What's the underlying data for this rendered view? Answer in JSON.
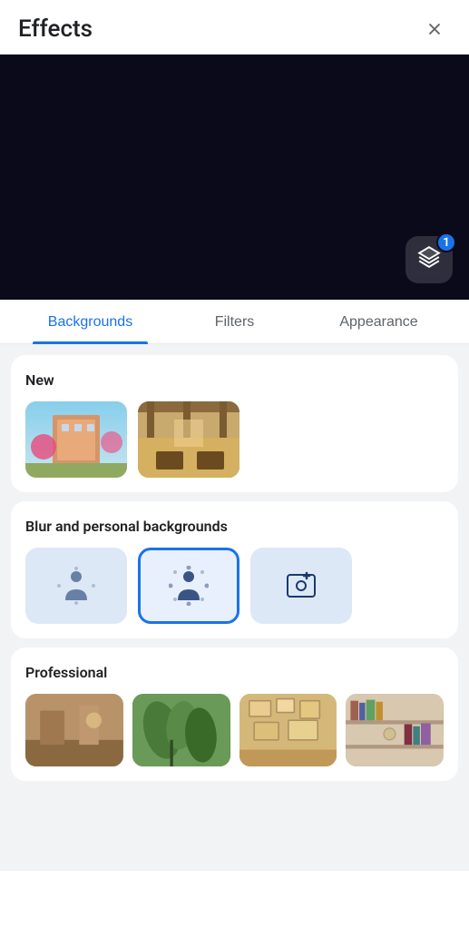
{
  "header": {
    "title": "Effects",
    "close_label": "Close"
  },
  "tabs": [
    {
      "id": "backgrounds",
      "label": "Backgrounds",
      "active": true
    },
    {
      "id": "filters",
      "label": "Filters",
      "active": false
    },
    {
      "id": "appearance",
      "label": "Appearance",
      "active": false
    }
  ],
  "sections": {
    "new": {
      "title": "New",
      "items": [
        {
          "id": "thumb1",
          "alt": "Background 1 - outdoor scene"
        },
        {
          "id": "thumb2",
          "alt": "Background 2 - indoor scene"
        }
      ]
    },
    "blur": {
      "title": "Blur and personal backgrounds",
      "items": [
        {
          "id": "blur-light",
          "type": "blur-light",
          "selected": false,
          "label": "Slight blur"
        },
        {
          "id": "blur-strong",
          "type": "blur-strong",
          "selected": true,
          "label": "Strong blur"
        },
        {
          "id": "add-photo",
          "type": "add",
          "label": "Add photo"
        }
      ]
    },
    "professional": {
      "title": "Professional",
      "items": [
        {
          "id": "pro1",
          "alt": "Professional background 1"
        },
        {
          "id": "pro2",
          "alt": "Professional background 2"
        },
        {
          "id": "pro3",
          "alt": "Professional background 3"
        },
        {
          "id": "pro4",
          "alt": "Professional background 4"
        }
      ]
    }
  },
  "badge": {
    "count": "1"
  }
}
